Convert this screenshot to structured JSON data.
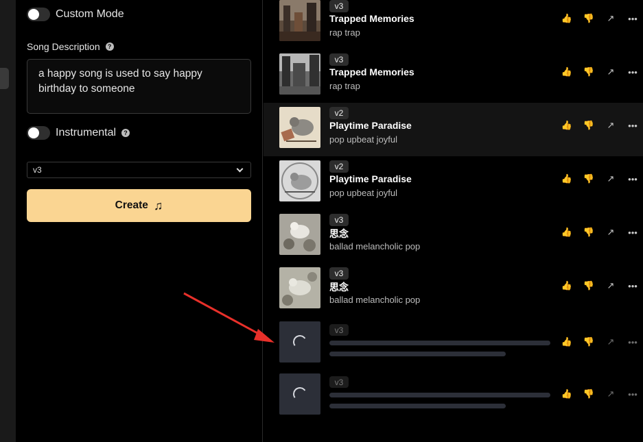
{
  "form": {
    "custom_mode_label": "Custom Mode",
    "song_description_label": "Song Description",
    "song_description_value": "a happy song is used to say happy birthday to someone",
    "instrumental_label": "Instrumental",
    "model_select_value": "v3",
    "create_label": "Create",
    "help_glyph": "?",
    "note_glyph": "♫"
  },
  "songs": [
    {
      "version": "v3",
      "title": "Trapped Memories",
      "tags": "rap trap"
    },
    {
      "version": "v3",
      "title": "Trapped Memories",
      "tags": "rap trap"
    },
    {
      "version": "v2",
      "title": "Playtime Paradise",
      "tags": "pop upbeat joyful"
    },
    {
      "version": "v2",
      "title": "Playtime Paradise",
      "tags": "pop upbeat joyful"
    },
    {
      "version": "v3",
      "title": "思念",
      "tags": "ballad melancholic pop"
    },
    {
      "version": "v3",
      "title": "思念",
      "tags": "ballad melancholic pop"
    }
  ],
  "pending": [
    {
      "version": "v3"
    },
    {
      "version": "v3"
    }
  ],
  "actions": {
    "like_glyph": "👍",
    "dislike_glyph": "👎",
    "share_glyph": "↗",
    "more_glyph": "•••"
  },
  "colors": {
    "accent": "#fad592",
    "annotation_arrow": "#e8302a"
  }
}
